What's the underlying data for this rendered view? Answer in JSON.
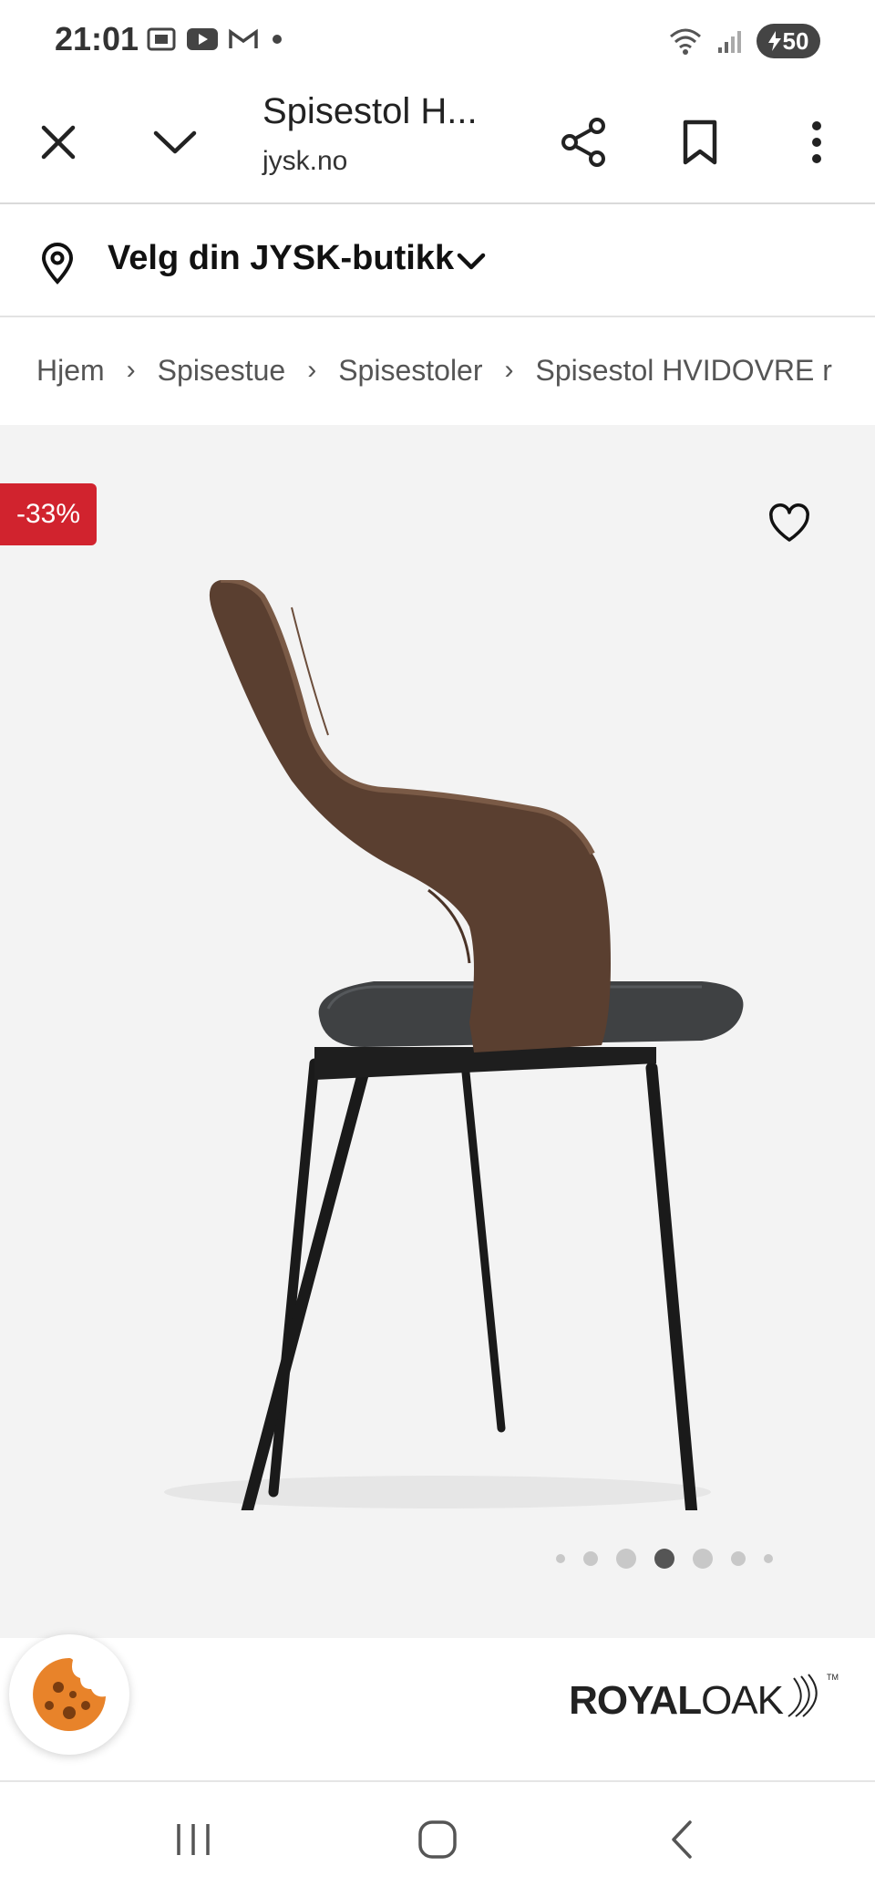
{
  "status_bar": {
    "time": "21:01",
    "battery": "50",
    "icons_left": [
      "screenshot-icon",
      "youtube-icon",
      "gmail-icon",
      "dot-icon"
    ],
    "icons_right": [
      "wifi-icon",
      "signal-icon",
      "battery-charging-icon"
    ]
  },
  "tab_header": {
    "title": "Spisestol H...",
    "domain": "jysk.no"
  },
  "store_selector": {
    "label": "Velg din JYSK-butikk"
  },
  "breadcrumb": {
    "items": [
      "Hjem",
      "Spisestue",
      "Spisestoler",
      "Spisestol HVIDOVRE r"
    ]
  },
  "product_gallery": {
    "discount_badge": "-33%",
    "slide_count": 7,
    "active_slide": 3,
    "background": "#f3f3f3"
  },
  "brand": {
    "royal": "ROYAL",
    "oak": "OAK",
    "tm": "TM"
  },
  "colors": {
    "discount": "#d1232e",
    "text": "#222222"
  }
}
